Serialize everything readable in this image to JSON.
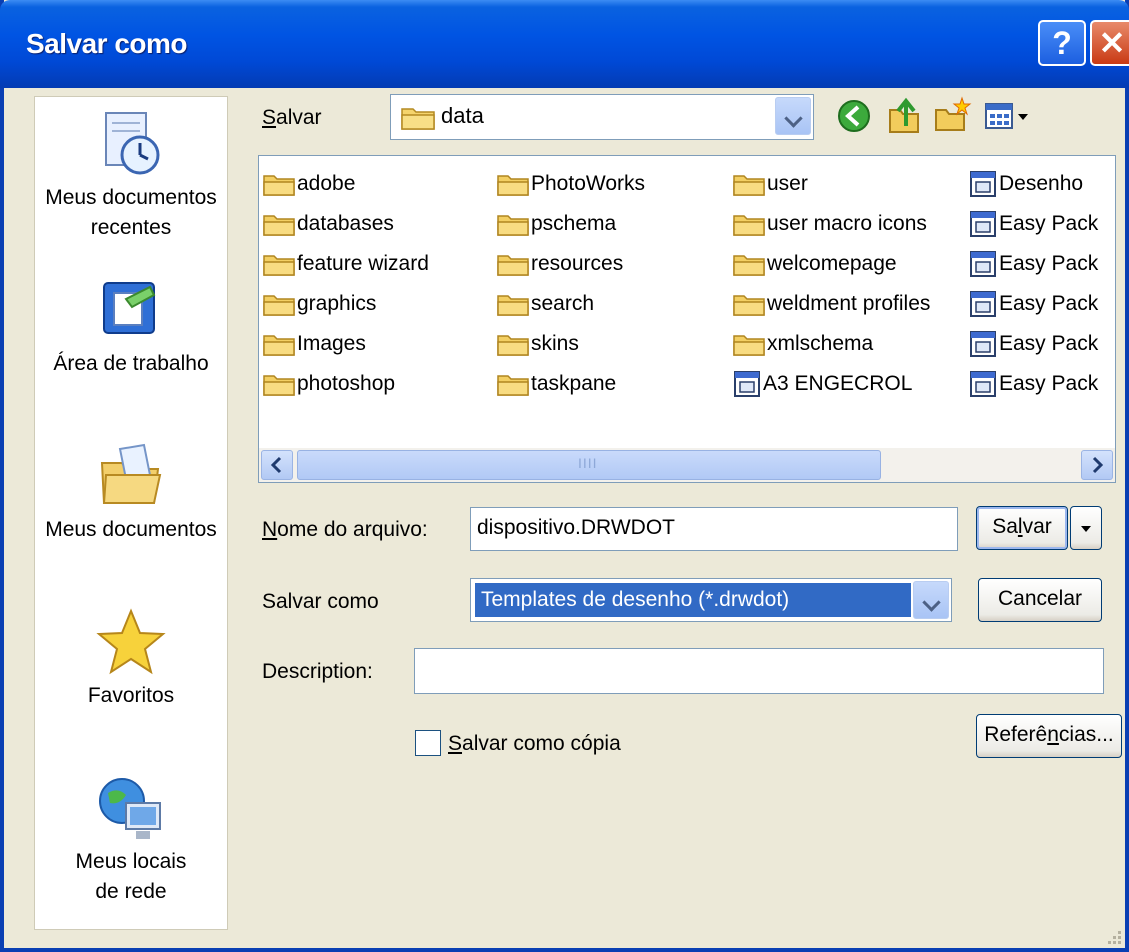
{
  "window": {
    "title": "Salvar como"
  },
  "places": [
    {
      "id": "recent",
      "label_line1": "Meus documentos",
      "label_line2": "recentes",
      "icon": "recent-documents-icon"
    },
    {
      "id": "desktop",
      "label_line1": "Área de trabalho",
      "label_line2": "",
      "icon": "desktop-icon"
    },
    {
      "id": "documents",
      "label_line1": "Meus documentos",
      "label_line2": "",
      "icon": "my-documents-icon"
    },
    {
      "id": "favorites",
      "label_line1": "Favoritos",
      "label_line2": "",
      "icon": "favorites-star-icon"
    },
    {
      "id": "network",
      "label_line1": "Meus locais",
      "label_line2": "de rede",
      "icon": "network-places-icon"
    }
  ],
  "lookin": {
    "label_u": "S",
    "label_rest": "alvar",
    "value": "data"
  },
  "files": {
    "col1": [
      "adobe",
      "databases",
      "feature wizard",
      "graphics",
      "Images",
      "photoshop"
    ],
    "col2": [
      "PhotoWorks",
      "pschema",
      "resources",
      "search",
      "skins",
      "taskpane"
    ],
    "col3": [
      "user",
      "user macro icons",
      "welcomepage",
      "weldment profiles",
      "xmlschema"
    ],
    "col3_doc": "A3 ENGECROL",
    "col4": [
      "Desenho",
      "Easy Pack",
      "Easy Pack",
      "Easy Pack",
      "Easy Pack",
      "Easy Pack"
    ]
  },
  "form": {
    "filename_label_u": "N",
    "filename_label_rest": "ome do arquivo:",
    "filename_value": "dispositivo.DRWDOT",
    "savetype_label": "Salvar como",
    "savetype_value": "Templates de desenho (*.drwdot)",
    "description_label": "Description:",
    "description_value": "",
    "save_as_copy_u": "S",
    "save_as_copy_rest": "alvar como cópia",
    "save_as_copy_checked": false
  },
  "buttons": {
    "save_pre": "Sa",
    "save_u": "l",
    "save_post": "var",
    "cancel": "Cancelar",
    "references_pre": "Referê",
    "references_u": "n",
    "references_post": "cias..."
  },
  "colors": {
    "title_bar": "#0054e3",
    "dialog_bg": "#ece9d8",
    "selection": "#316ac5"
  }
}
